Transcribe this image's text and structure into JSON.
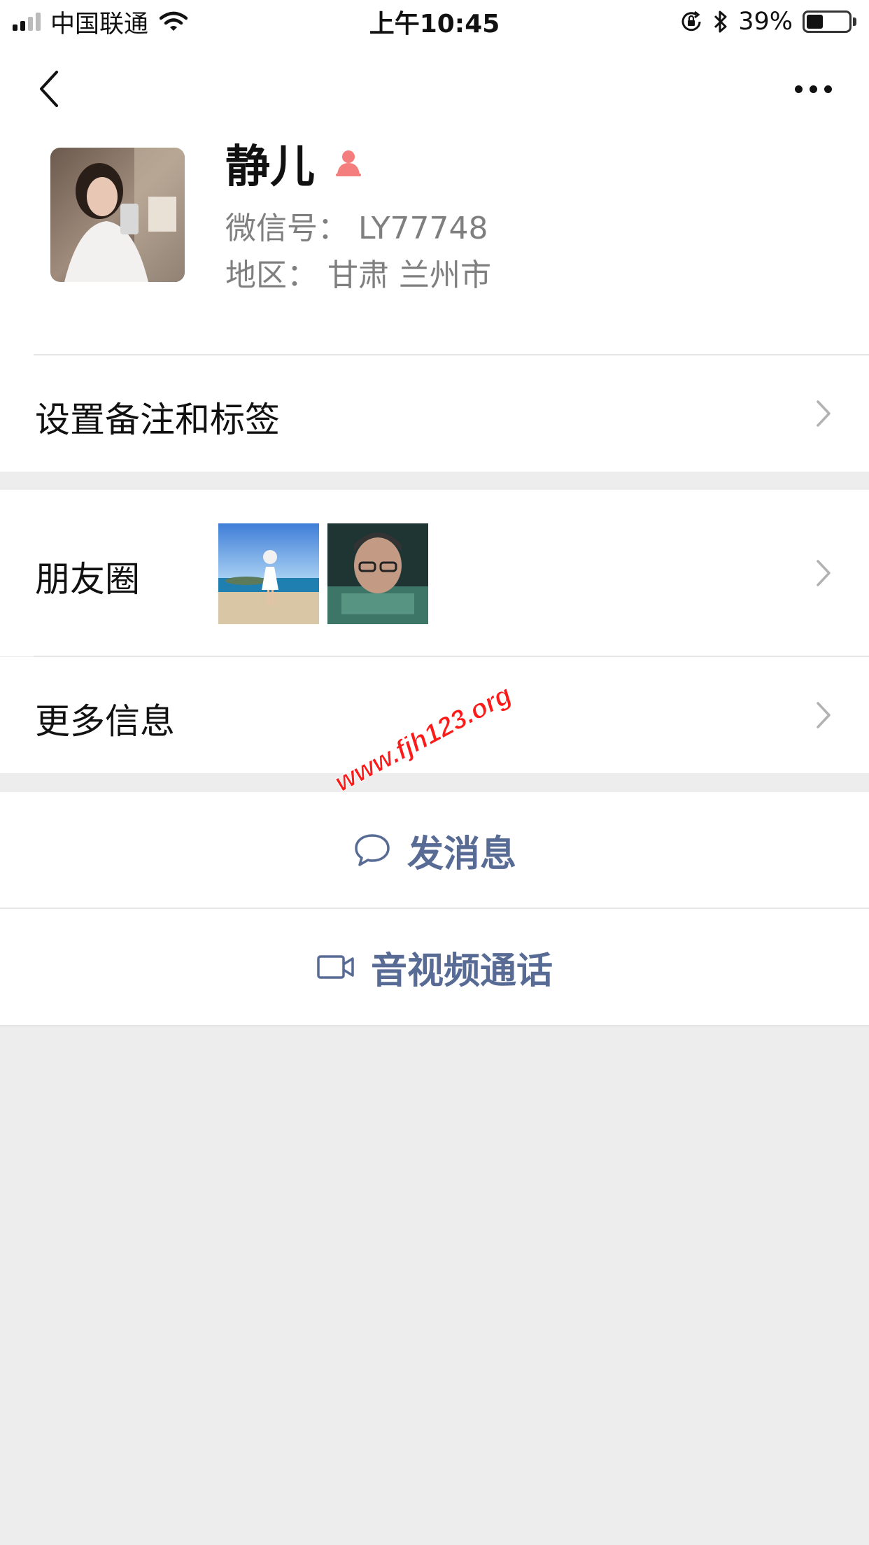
{
  "status_bar": {
    "carrier": "中国联通",
    "time": "上午10:45",
    "battery": "39%",
    "battery_level": 0.39,
    "icons": [
      "signal-icon",
      "wifi-icon",
      "orientation-lock-icon",
      "bluetooth-icon",
      "battery-icon"
    ]
  },
  "nav": {
    "back_icon": "chevron-left-icon",
    "more_icon": "more-dots-icon"
  },
  "profile": {
    "name": "静儿",
    "gender": "female",
    "gender_color": "#f37e7d",
    "wechat_id": "微信号： LY77748",
    "region": "地区： 甘肃 兰州市"
  },
  "cells": {
    "remark_tags": "设置备注和标签",
    "moments": "朋友圈",
    "more_info": "更多信息"
  },
  "actions": {
    "send_message": "发消息",
    "video_call": "音视频通话",
    "accent_color": "#576b95"
  },
  "watermark": "www.fjh123.org"
}
